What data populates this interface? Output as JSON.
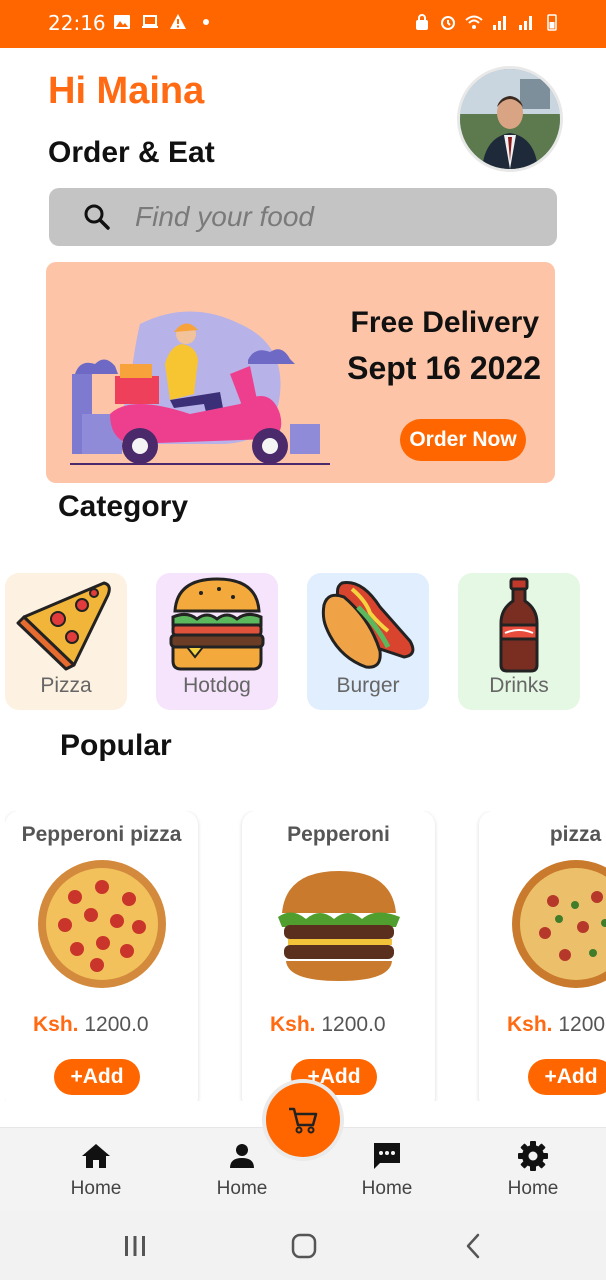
{
  "status_bar": {
    "time": "22:16",
    "color": "#ff6600"
  },
  "header": {
    "greeting": "Hi Maina",
    "subtitle": "Order & Eat",
    "accent": "#ff6a13"
  },
  "search": {
    "placeholder": "Find your food"
  },
  "promo": {
    "title": "Free Delivery",
    "date": "Sept 16 2022",
    "button_label": "Order Now",
    "background": "#fdc4a8"
  },
  "categories": {
    "title": "Category",
    "items": [
      {
        "label": "Pizza",
        "icon": "pizza-icon",
        "background": "#fdf1e2"
      },
      {
        "label": "Hotdog",
        "icon": "burger-icon",
        "background": "#f5e4fb"
      },
      {
        "label": "Burger",
        "icon": "hotdog-icon",
        "background": "#e1eefd"
      },
      {
        "label": "Drinks",
        "icon": "bottle-icon",
        "background": "#e5f8e3"
      }
    ]
  },
  "popular": {
    "title": "Popular",
    "items": [
      {
        "name": "Pepperoni pizza",
        "currency": "Ksh.",
        "price": "1200.0",
        "button_label": "+Add"
      },
      {
        "name": "Pepperoni",
        "currency": "Ksh.",
        "price": "1200.0",
        "button_label": "+Add"
      },
      {
        "name": "pizza",
        "currency": "Ksh.",
        "price": "1200.0",
        "button_label": "+Add"
      }
    ]
  },
  "bottom_nav": {
    "items": [
      {
        "label": "Home",
        "icon": "home-icon"
      },
      {
        "label": "Home",
        "icon": "person-icon"
      },
      {
        "label": "Home",
        "icon": "chat-icon"
      },
      {
        "label": "Home",
        "icon": "gear-icon"
      }
    ],
    "fab_icon": "cart-icon"
  }
}
